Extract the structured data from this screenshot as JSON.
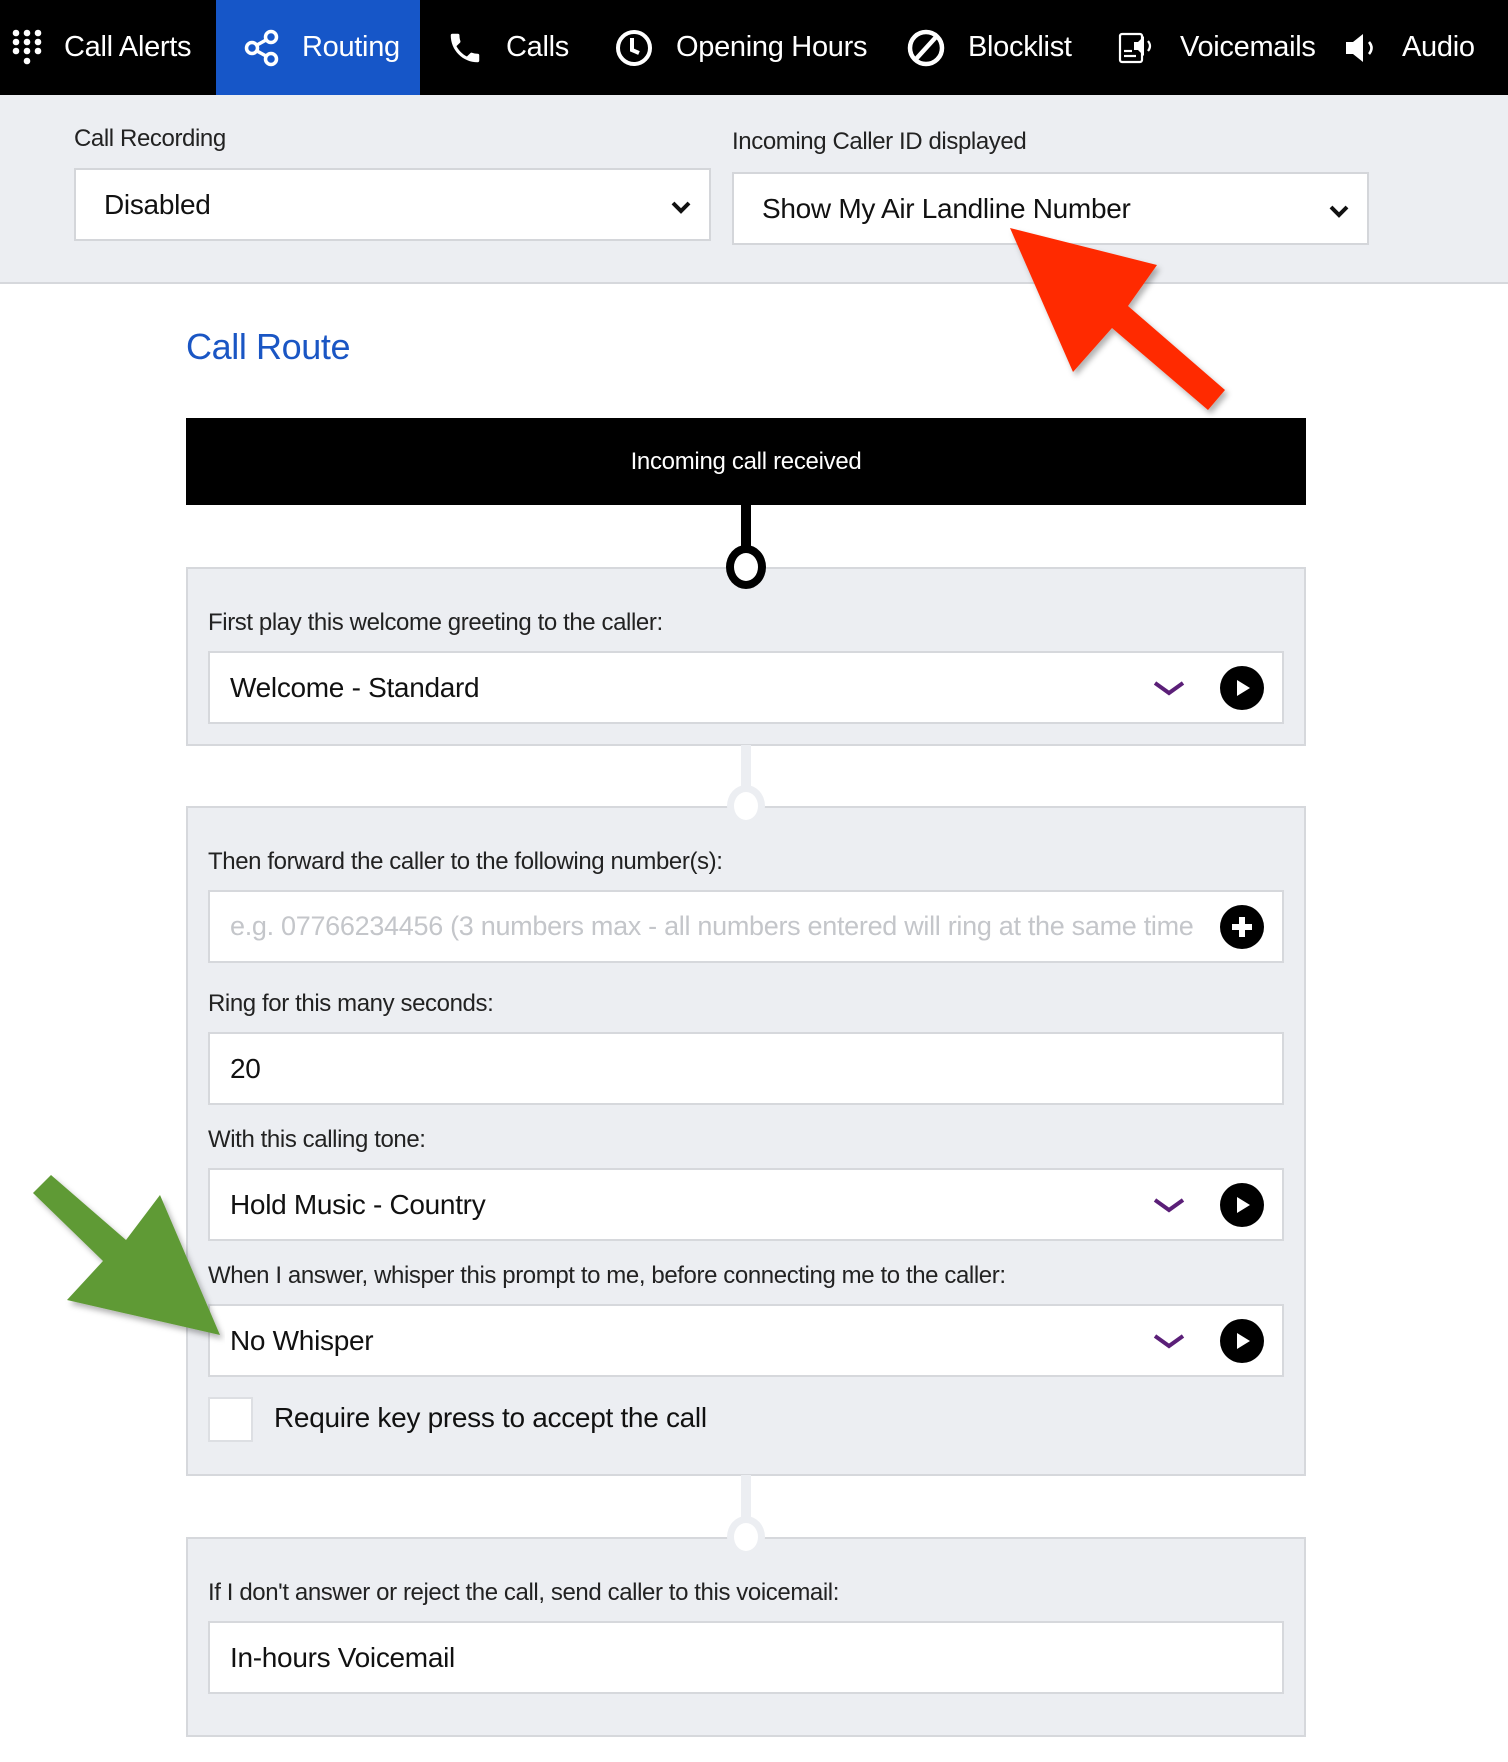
{
  "nav": {
    "items": [
      {
        "label": "Call Alerts",
        "icon": "dialpad-icon",
        "active": false
      },
      {
        "label": "Routing",
        "icon": "share-nodes-icon",
        "active": true
      },
      {
        "label": "Calls",
        "icon": "phone-icon",
        "active": false
      },
      {
        "label": "Opening Hours",
        "icon": "clock-icon",
        "active": false
      },
      {
        "label": "Blocklist",
        "icon": "block-icon",
        "active": false
      },
      {
        "label": "Voicemails",
        "icon": "voicemail-icon",
        "active": false
      },
      {
        "label": "Audio",
        "icon": "speaker-icon",
        "active": false
      }
    ],
    "active_color": "#1656c8"
  },
  "settings": {
    "call_recording": {
      "label": "Call Recording",
      "value": "Disabled"
    },
    "caller_id": {
      "label": "Incoming Caller ID displayed",
      "value": "Show My Air Landline Number"
    }
  },
  "call_route": {
    "title": "Call Route",
    "start_label": "Incoming call received",
    "greeting": {
      "label": "First play this welcome greeting to the caller:",
      "value": "Welcome - Standard"
    },
    "forward": {
      "label": "Then forward the caller to the following number(s):",
      "placeholder": "e.g. 07766234456 (3 numbers max - all numbers entered will ring at the same time"
    },
    "ring_seconds": {
      "label": "Ring for this many seconds:",
      "value": "20"
    },
    "calling_tone": {
      "label": "With this calling tone:",
      "value": "Hold Music - Country"
    },
    "whisper": {
      "label": "When I answer, whisper this prompt to me, before connecting me to the caller:",
      "value": "No Whisper"
    },
    "key_press": {
      "label": "Require key press to accept the call",
      "checked": false
    },
    "voicemail": {
      "label": "If I don't answer or reject the call, send caller to this voicemail:",
      "value": "In-hours Voicemail"
    }
  },
  "colors": {
    "title_blue": "#1a56c4",
    "chevron_purple": "#5b1f78",
    "annotation_red": "#ff2a00",
    "annotation_green": "#5f9a35"
  }
}
